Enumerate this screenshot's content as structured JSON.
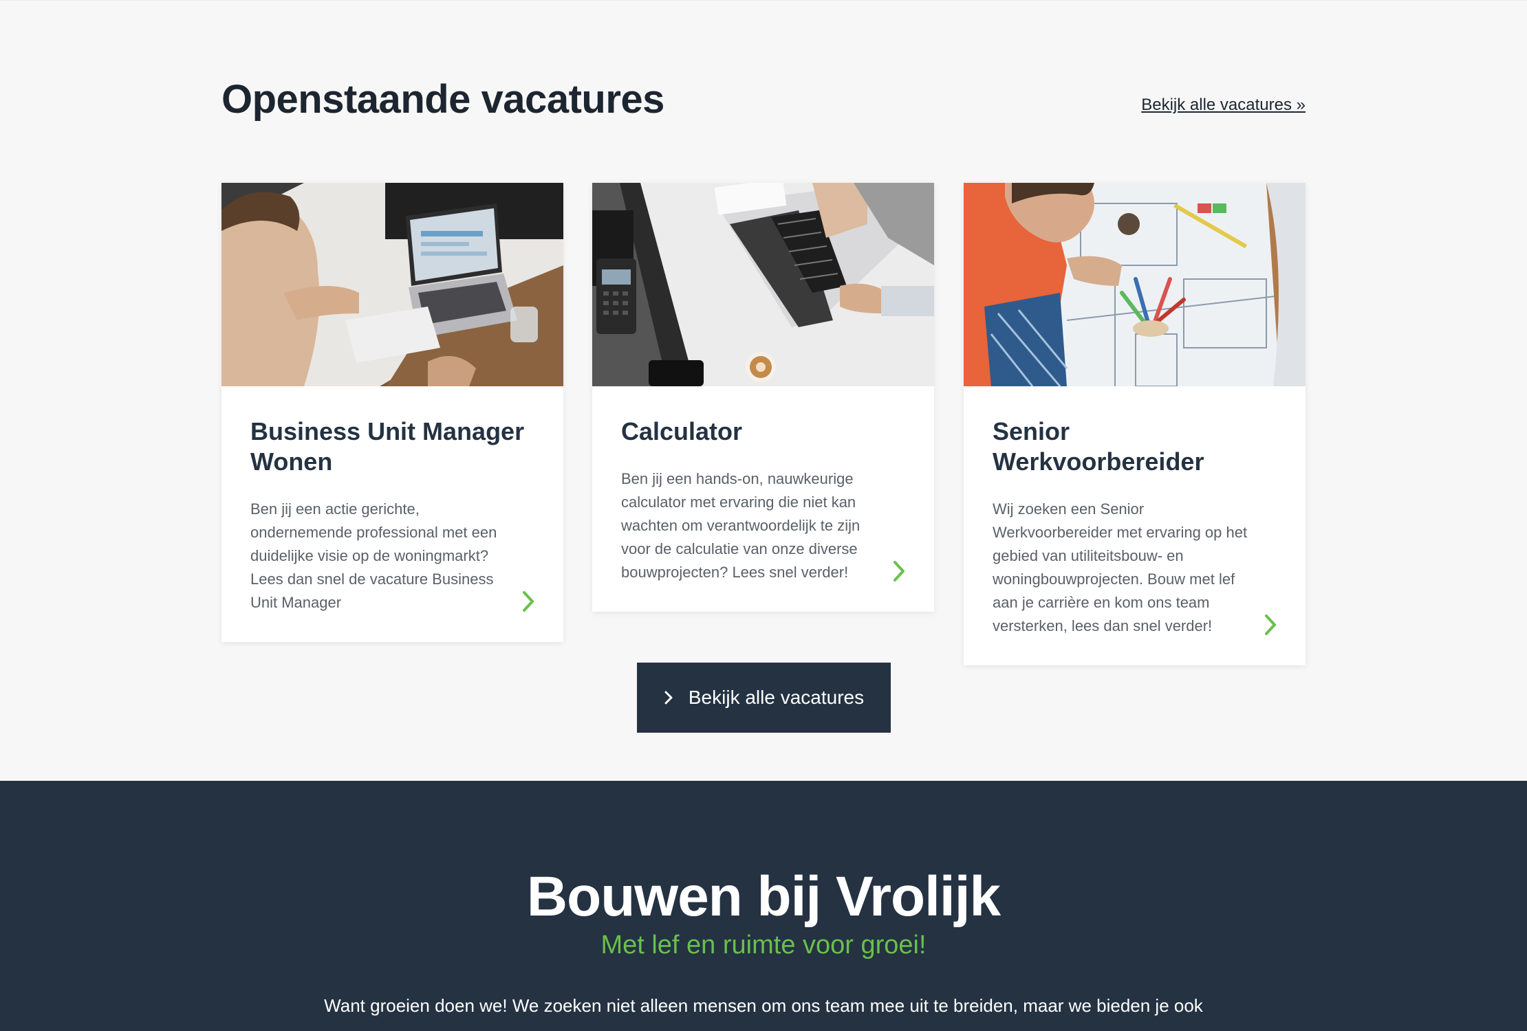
{
  "vacancies": {
    "title": "Openstaande vacatures",
    "view_all_link": "Bekijk alle vacatures »",
    "cards": [
      {
        "title": "Business Unit Manager Wonen",
        "description": "Ben jij een actie gerichte, ondernemende professional met een duidelijke visie op de woningmarkt? Lees dan snel de vacature Business Unit Manager",
        "image": "office-laptop-photo"
      },
      {
        "title": "Calculator",
        "description": "Ben jij een hands-on, nauwkeurige calculator met ervaring die niet kan wachten om verantwoordelijk te zijn voor de calculatie van onze diverse bouwprojecten? Lees snel verder!",
        "image": "laptop-desk-photo"
      },
      {
        "title": "Senior Werkvoorbereider",
        "description": "Wij zoeken een Senior Werkvoorbereider met ervaring op het gebied van utiliteitsbouw- en woningbouwprojecten. Bouw met lef aan je carrière en kom ons team versterken, lees dan snel verder!",
        "image": "blueprint-photo"
      }
    ],
    "button_label": "Bekijk alle vacatures"
  },
  "about": {
    "title": "Bouwen bij Vrolijk",
    "subtitle": "Met lef en ruimte voor groei!",
    "intro": "Want groeien doen we! We zoeken niet alleen mensen om ons team mee uit te breiden, maar we bieden je ook"
  },
  "colors": {
    "navy": "#243242",
    "accent_green": "#6ac04a",
    "background": "#f7f7f7"
  }
}
